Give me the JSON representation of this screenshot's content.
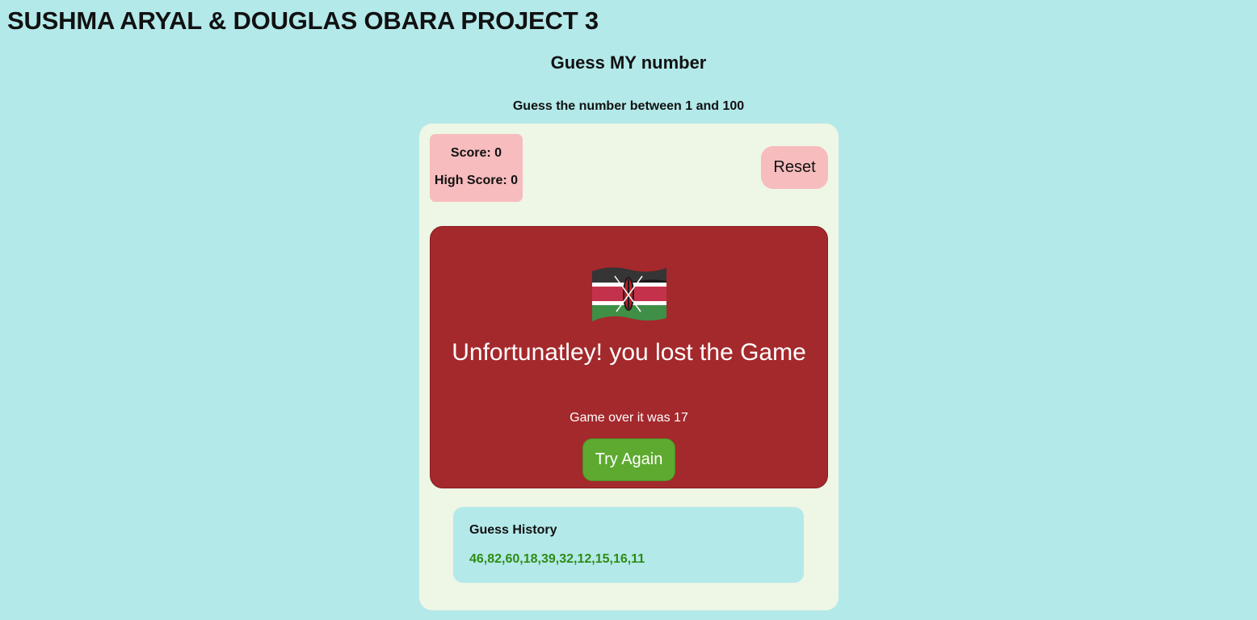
{
  "header": {
    "title": "SUSHMA ARYAL & DOUGLAS OBARA PROJECT 3"
  },
  "game": {
    "title": "Guess MY number",
    "instructions": "Guess the number between 1 and 100"
  },
  "scoreboard": {
    "score": "Score: 0",
    "high_score": "High Score: 0"
  },
  "controls": {
    "reset_label": "Reset"
  },
  "result": {
    "icon": "kenya-flag-icon",
    "message": "Unfortunatley! you lost the Game",
    "game_over_text": "Game over it was 17",
    "try_again_label": "Try Again"
  },
  "history": {
    "title": "Guess History",
    "values": "46,82,60,18,39,32,12,15,16,11"
  },
  "colors": {
    "background": "#b4e9ea",
    "card": "#eef6e5",
    "scoreboard": "#f7bcbe",
    "result_panel": "#a4292c",
    "try_again": "#5eaa30",
    "history_values": "#2e8b14"
  }
}
